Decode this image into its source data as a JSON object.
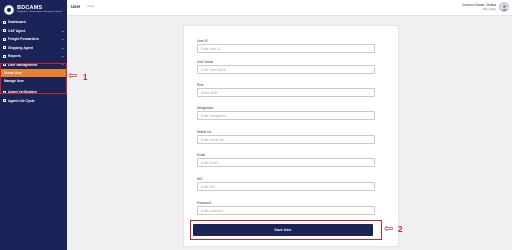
{
  "brand": {
    "title": "BDCAMS",
    "subtitle": "Bangladesh Customs Agents Management System"
  },
  "sidebar": {
    "items": [
      {
        "label": "Dashboard",
        "icon": "dashboard-icon",
        "chevron": ""
      },
      {
        "label": "C&F Agent",
        "icon": "agent-icon",
        "chevron": "⌄"
      },
      {
        "label": "Freight Forwarders",
        "icon": "freight-icon",
        "chevron": "⌄"
      },
      {
        "label": "Shipping Agent",
        "icon": "ship-icon",
        "chevron": "⌄"
      },
      {
        "label": "Reports",
        "icon": "report-icon",
        "chevron": "⌄"
      },
      {
        "label": "User Management",
        "icon": "users-icon",
        "chevron": "⌃"
      }
    ],
    "sub_items": [
      {
        "label": "Create User",
        "active": true
      },
      {
        "label": "Manage User",
        "active": false
      }
    ],
    "bottom_items": [
      {
        "label": "Agent Verification",
        "icon": "verify-icon"
      },
      {
        "label": "Agent Life Cycle",
        "icon": "cycle-icon"
      }
    ]
  },
  "header": {
    "title": "User",
    "subtitle": "create",
    "user_name": "Custom House, Dhaka",
    "user_role": "Office Admin"
  },
  "form": {
    "fields": [
      {
        "label": "User ID",
        "placeholder": "Enter User ID",
        "type": "input"
      },
      {
        "label": "User Name",
        "placeholder": "Enter User Name",
        "type": "input"
      },
      {
        "label": "Role",
        "placeholder": "Select Role",
        "type": "select"
      },
      {
        "label": "Designation",
        "placeholder": "Enter Designation",
        "type": "input"
      },
      {
        "label": "Mobile No",
        "placeholder": "Enter Mobile No",
        "type": "input"
      },
      {
        "label": "Email",
        "placeholder": "Enter Email",
        "type": "input"
      },
      {
        "label": "NID",
        "placeholder": "Enter NID",
        "type": "input"
      },
      {
        "label": "Password",
        "placeholder": "Enter password",
        "type": "input"
      }
    ],
    "save_label": "Save User"
  },
  "annotations": {
    "first": "1",
    "second": "2",
    "arrow": "⇦"
  },
  "colors": {
    "sidebar_bg": "#1b2459",
    "active": "#e8812f",
    "annotation": "#d42020"
  }
}
